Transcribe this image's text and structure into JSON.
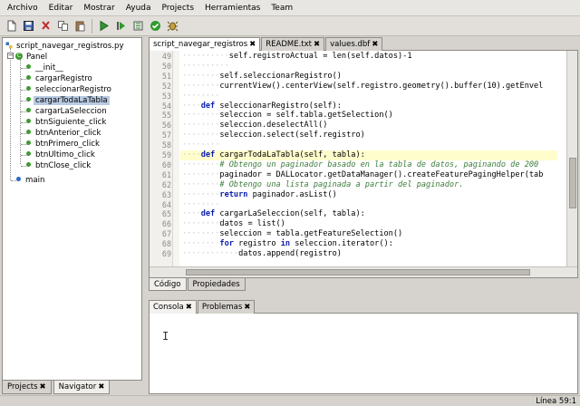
{
  "menu": [
    "Archivo",
    "Editar",
    "Mostrar",
    "Ayuda",
    "Projects",
    "Herramientas",
    "Team"
  ],
  "toolbar": [
    "new-file-icon",
    "save-icon",
    "cut-icon",
    "copy-icon",
    "paste-icon",
    "run-icon",
    "build-icon",
    "build-all-icon",
    "check-icon",
    "debug-icon"
  ],
  "navigator": {
    "root": "script_navegar_registros.py",
    "class": "Panel",
    "methods": [
      "__init__",
      "cargarRegistro",
      "seleccionarRegistro",
      "cargarTodaLaTabla",
      "cargarLaSeleccion",
      "btnSiguiente_click",
      "btnAnterior_click",
      "btnPrimero_click",
      "btnUltimo_click",
      "btnClose_click"
    ],
    "selected": "cargarTodaLaTabla",
    "main": "main"
  },
  "left_tabs": [
    "Projects",
    "Navigator"
  ],
  "editor_tabs": [
    "script_navegar_registros",
    "README.txt",
    "values.dbf"
  ],
  "code": {
    "current_line": 59,
    "lines": [
      {
        "n": "49",
        "indent": "··········",
        "parts": [
          [
            "",
            "self.registroActual = len(self.datos)-1"
          ]
        ]
      },
      {
        "n": "50",
        "indent": "··········",
        "parts": []
      },
      {
        "n": "51",
        "indent": "········",
        "parts": [
          [
            "",
            "self.seleccionarRegistro()"
          ]
        ]
      },
      {
        "n": "52",
        "indent": "········",
        "parts": [
          [
            "",
            "currentView().centerView(self.registro.geometry().buffer(10).getEnvel"
          ]
        ]
      },
      {
        "n": "53",
        "indent": "········",
        "parts": []
      },
      {
        "n": "54",
        "indent": "····",
        "parts": [
          [
            "kw",
            "def"
          ],
          [
            "",
            " seleccionarRegistro(self):"
          ]
        ]
      },
      {
        "n": "55",
        "indent": "········",
        "parts": [
          [
            "",
            "seleccion = self.tabla.getSelection()"
          ]
        ]
      },
      {
        "n": "56",
        "indent": "········",
        "parts": [
          [
            "",
            "seleccion.deselectAll()"
          ]
        ]
      },
      {
        "n": "57",
        "indent": "········",
        "parts": [
          [
            "",
            "seleccion.select(self.registro)"
          ]
        ]
      },
      {
        "n": "58",
        "indent": "········",
        "parts": []
      },
      {
        "n": "59",
        "indent": "····",
        "parts": [
          [
            "kw",
            "def"
          ],
          [
            "",
            " cargarTodaLaTabla(self, tabla):"
          ]
        ]
      },
      {
        "n": "60",
        "indent": "········",
        "parts": [
          [
            "cm",
            "# Obtengo un paginador basado en la tabla de datos, paginando de 200"
          ]
        ]
      },
      {
        "n": "61",
        "indent": "········",
        "parts": [
          [
            "",
            "paginador = DALLocator.getDataManager().createFeaturePagingHelper(tab"
          ]
        ]
      },
      {
        "n": "62",
        "indent": "········",
        "parts": [
          [
            "cm",
            "# Obtengo una lista paginada a partir del paginador."
          ]
        ]
      },
      {
        "n": "63",
        "indent": "········",
        "parts": [
          [
            "kw",
            "return"
          ],
          [
            "",
            " paginador.asList()"
          ]
        ]
      },
      {
        "n": "64",
        "indent": "········",
        "parts": []
      },
      {
        "n": "65",
        "indent": "····",
        "parts": [
          [
            "kw",
            "def"
          ],
          [
            "",
            " cargarLaSeleccion(self, tabla):"
          ]
        ]
      },
      {
        "n": "66",
        "indent": "········",
        "parts": [
          [
            "",
            "datos = list()"
          ]
        ]
      },
      {
        "n": "67",
        "indent": "········",
        "parts": [
          [
            "",
            "seleccion = tabla.getFeatureSelection()"
          ]
        ]
      },
      {
        "n": "68",
        "indent": "········",
        "parts": [
          [
            "kw",
            "for"
          ],
          [
            "",
            " registro "
          ],
          [
            "kw",
            "in"
          ],
          [
            "",
            " seleccion.iterator():"
          ]
        ]
      },
      {
        "n": "69",
        "indent": "············",
        "parts": [
          [
            "",
            "datos.append(registro)"
          ]
        ]
      }
    ]
  },
  "editor_bottom_tabs": [
    "Código",
    "Propiedades"
  ],
  "console_tabs": [
    "Consola",
    "Problemas"
  ],
  "status": "Línea 59:1"
}
